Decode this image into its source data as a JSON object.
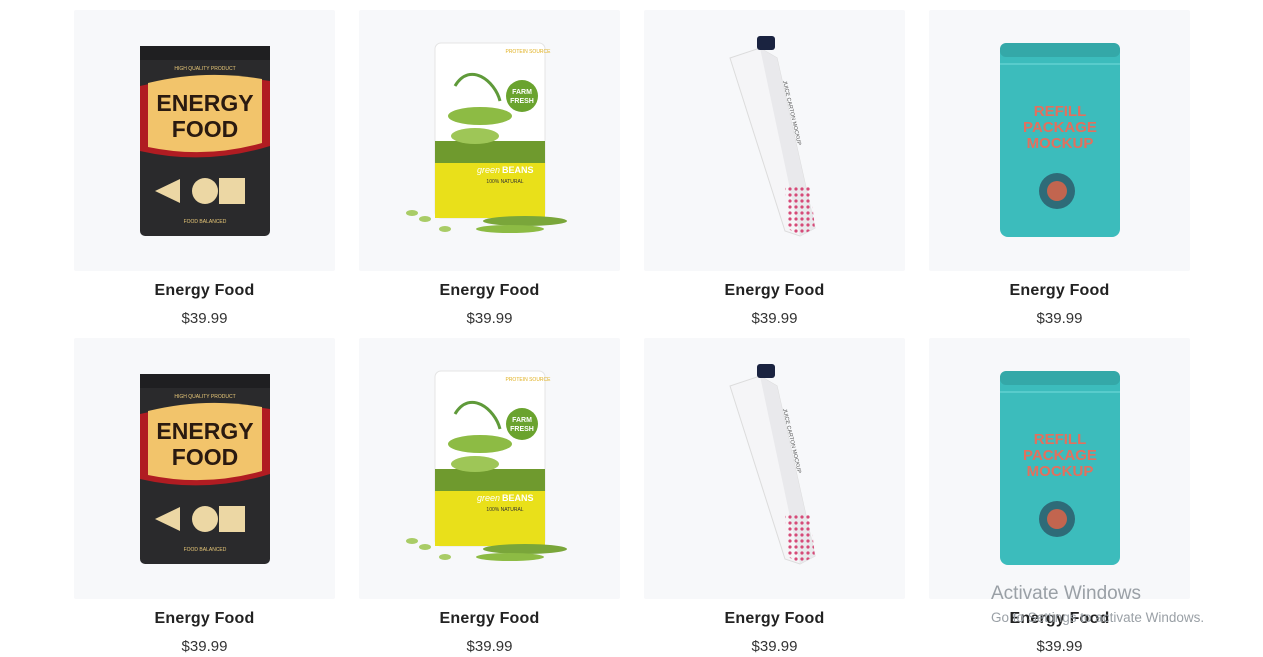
{
  "products": [
    {
      "name": "Energy Food",
      "price": "$39.99",
      "image": "energy-food-bag",
      "pack_line1": "ENERGY",
      "pack_line2": "FOOD",
      "pack_top": "HIGH QUALITY PRODUCT",
      "pack_bottom": "FOOD BALANCED"
    },
    {
      "name": "Energy Food",
      "price": "$39.99",
      "image": "green-beans-pouch",
      "pack_tag": "PROTEIN SOURCE",
      "pack_badge1": "FARM",
      "pack_badge2": "FRESH",
      "pack_brand1": "green",
      "pack_brand2": "BEANS",
      "pack_sub": "100% NATURAL"
    },
    {
      "name": "Energy Food",
      "price": "$39.99",
      "image": "juice-carton",
      "pack_text": "JUICE CARTON MOCKUP"
    },
    {
      "name": "Energy Food",
      "price": "$39.99",
      "image": "refill-pouch",
      "pack_line1": "REFILL",
      "pack_line2": "PACKAGE",
      "pack_line3": "MOCKUP"
    },
    {
      "name": "Energy Food",
      "price": "$39.99",
      "image": "energy-food-bag",
      "pack_line1": "ENERGY",
      "pack_line2": "FOOD",
      "pack_top": "HIGH QUALITY PRODUCT",
      "pack_bottom": "FOOD BALANCED"
    },
    {
      "name": "Energy Food",
      "price": "$39.99",
      "image": "green-beans-pouch",
      "pack_tag": "PROTEIN SOURCE",
      "pack_badge1": "FARM",
      "pack_badge2": "FRESH",
      "pack_brand1": "green",
      "pack_brand2": "BEANS",
      "pack_sub": "100% NATURAL"
    },
    {
      "name": "Energy Food",
      "price": "$39.99",
      "image": "juice-carton",
      "pack_text": "JUICE CARTON MOCKUP"
    },
    {
      "name": "Energy Food",
      "price": "$39.99",
      "image": "refill-pouch",
      "pack_line1": "REFILL",
      "pack_line2": "PACKAGE",
      "pack_line3": "MOCKUP"
    }
  ],
  "watermark": {
    "title": "Activate Windows",
    "subtitle": "Go to Settings to activate Windows."
  },
  "colors": {
    "card_bg": "#f7f8fa",
    "bag_dark": "#2a2a2c",
    "bag_yellow": "#f2c46b",
    "bag_red": "#b01c22",
    "beans_green": "#7aa63a",
    "pouch_yellow": "#e9e01a",
    "carton_pink": "#d64a78",
    "refill_teal": "#3cbcbc",
    "refill_text": "#e2705e"
  }
}
